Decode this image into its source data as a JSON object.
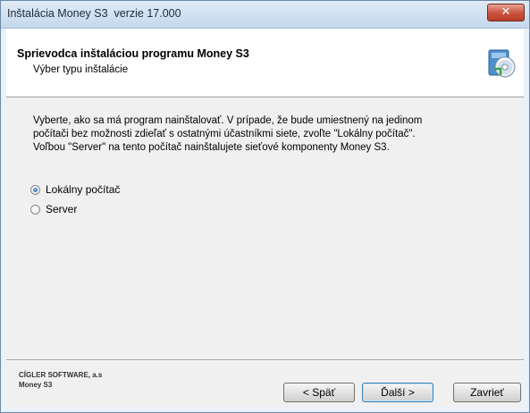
{
  "window": {
    "title": "Inštalácia Money S3  verzie 17.000",
    "close_label": "✕"
  },
  "header": {
    "title": "Sprievodca inštaláciou programu Money S3",
    "subtitle": "Výber typu inštalácie",
    "icon": "install-cd-icon"
  },
  "description": {
    "lines": [
      "Vyberte, ako sa má program nainštalovať. V prípade, že bude umiestnený na jedinom",
      "počítači bez možnosti zdieľať s ostatnými účastníkmi siete, zvoľte \"Lokálny počítač\".",
      "Voľbou \"Server\" na tento počítač nainštalujete sieťové komponenty Money S3."
    ]
  },
  "options": [
    {
      "label": "Lokálny počítač",
      "selected": true
    },
    {
      "label": "Server",
      "selected": false
    }
  ],
  "footer": {
    "company": "CÍGLER SOFTWARE, a.s",
    "product": "Money S3"
  },
  "buttons": {
    "back": "< Späť",
    "next": "Ďalší >",
    "cancel": "Zavrieť"
  },
  "colors": {
    "title_bar": "#c5d8ec",
    "close_button": "#c8523c",
    "default_button_border": "#3c7fb1"
  }
}
